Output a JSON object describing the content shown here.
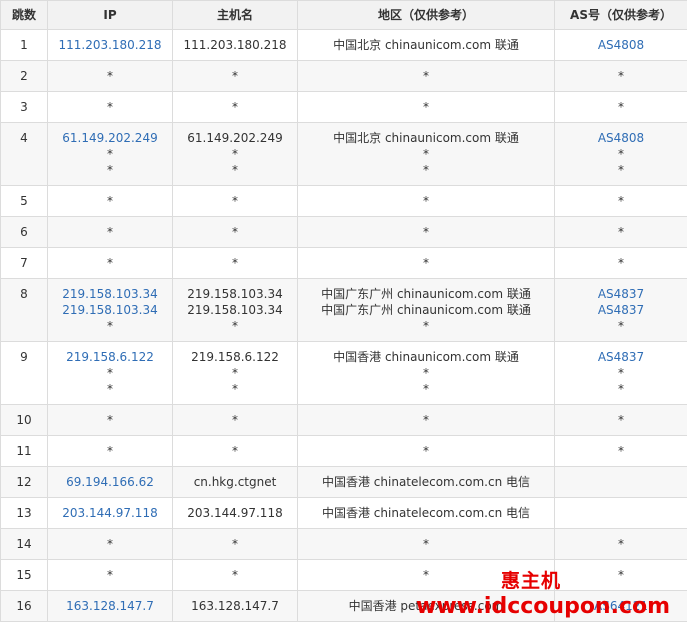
{
  "headers": {
    "hop": "跳数",
    "ip": "IP",
    "host": "主机名",
    "region": "地区（仅供参考）",
    "as": "AS号（仅供参考）"
  },
  "rows": [
    {
      "hop": "1",
      "ip": [
        "111.203.180.218"
      ],
      "host": [
        "111.203.180.218"
      ],
      "region": [
        "中国北京 chinaunicom.com 联通"
      ],
      "as": [
        "AS4808"
      ]
    },
    {
      "hop": "2",
      "ip": [
        "*"
      ],
      "host": [
        "*"
      ],
      "region": [
        "*"
      ],
      "as": [
        "*"
      ]
    },
    {
      "hop": "3",
      "ip": [
        "*"
      ],
      "host": [
        "*"
      ],
      "region": [
        "*"
      ],
      "as": [
        "*"
      ]
    },
    {
      "hop": "4",
      "ip": [
        "61.149.202.249",
        "*",
        "*"
      ],
      "host": [
        "61.149.202.249",
        "*",
        "*"
      ],
      "region": [
        "中国北京 chinaunicom.com 联通",
        "*",
        "*"
      ],
      "as": [
        "AS4808",
        "*",
        "*"
      ]
    },
    {
      "hop": "5",
      "ip": [
        "*"
      ],
      "host": [
        "*"
      ],
      "region": [
        "*"
      ],
      "as": [
        "*"
      ]
    },
    {
      "hop": "6",
      "ip": [
        "*"
      ],
      "host": [
        "*"
      ],
      "region": [
        "*"
      ],
      "as": [
        "*"
      ]
    },
    {
      "hop": "7",
      "ip": [
        "*"
      ],
      "host": [
        "*"
      ],
      "region": [
        "*"
      ],
      "as": [
        "*"
      ]
    },
    {
      "hop": "8",
      "ip": [
        "219.158.103.34",
        "219.158.103.34",
        "*"
      ],
      "host": [
        "219.158.103.34",
        "219.158.103.34",
        "*"
      ],
      "region": [
        "中国广东广州 chinaunicom.com 联通",
        "中国广东广州 chinaunicom.com 联通",
        "*"
      ],
      "as": [
        "AS4837",
        "AS4837",
        "*"
      ]
    },
    {
      "hop": "9",
      "ip": [
        "219.158.6.122",
        "*",
        "*"
      ],
      "host": [
        "219.158.6.122",
        "*",
        "*"
      ],
      "region": [
        "中国香港 chinaunicom.com 联通",
        "*",
        "*"
      ],
      "as": [
        "AS4837",
        "*",
        "*"
      ]
    },
    {
      "hop": "10",
      "ip": [
        "*"
      ],
      "host": [
        "*"
      ],
      "region": [
        "*"
      ],
      "as": [
        "*"
      ]
    },
    {
      "hop": "11",
      "ip": [
        "*"
      ],
      "host": [
        "*"
      ],
      "region": [
        "*"
      ],
      "as": [
        "*"
      ]
    },
    {
      "hop": "12",
      "ip": [
        "69.194.166.62"
      ],
      "host": [
        "cn.hkg.ctgnet"
      ],
      "region": [
        "中国香港 chinatelecom.com.cn 电信"
      ],
      "as": [
        ""
      ]
    },
    {
      "hop": "13",
      "ip": [
        "203.144.97.118"
      ],
      "host": [
        "203.144.97.118"
      ],
      "region": [
        "中国香港 chinatelecom.com.cn 电信"
      ],
      "as": [
        ""
      ]
    },
    {
      "hop": "14",
      "ip": [
        "*"
      ],
      "host": [
        "*"
      ],
      "region": [
        "*"
      ],
      "as": [
        "*"
      ]
    },
    {
      "hop": "15",
      "ip": [
        "*"
      ],
      "host": [
        "*"
      ],
      "region": [
        "*"
      ],
      "as": [
        "*"
      ]
    },
    {
      "hop": "16",
      "ip": [
        "163.128.147.7"
      ],
      "host": [
        "163.128.147.7"
      ],
      "region": [
        "中国香港 petaexpress.com"
      ],
      "as": [
        "AS64121"
      ]
    }
  ],
  "watermark": {
    "brand": "惠主机",
    "url": "www.idccoupon.com"
  },
  "colors": {
    "link": "#2f6db5",
    "header_bg": "#f2f2f2",
    "border": "#dcdcdc",
    "watermark": "#e60000"
  }
}
